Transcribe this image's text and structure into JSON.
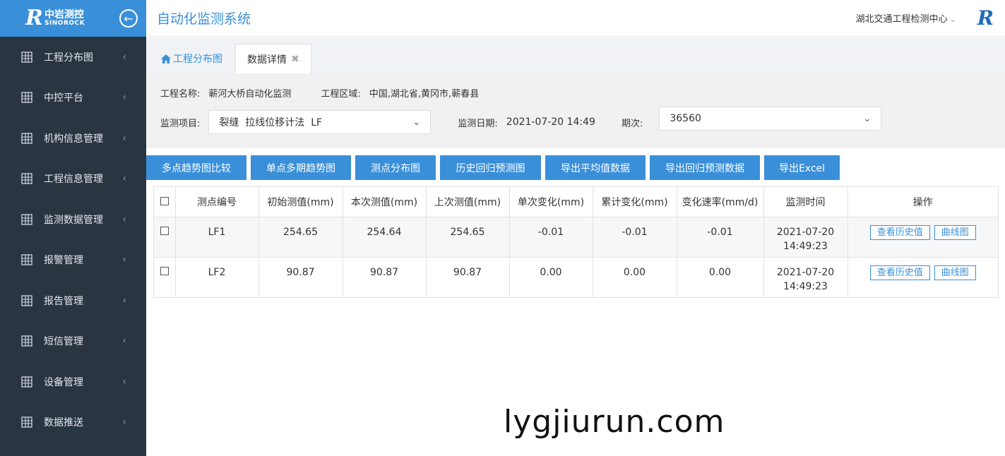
{
  "sidebar": {
    "logo_mark": "R",
    "logo_cn": "中岩测控",
    "logo_en": "SINOROCK",
    "items": [
      {
        "label": "工程分布图"
      },
      {
        "label": "中控平台"
      },
      {
        "label": "机构信息管理"
      },
      {
        "label": "工程信息管理"
      },
      {
        "label": "监测数据管理"
      },
      {
        "label": "报警管理"
      },
      {
        "label": "报告管理"
      },
      {
        "label": "短信管理"
      },
      {
        "label": "设备管理"
      },
      {
        "label": "数据推送"
      }
    ]
  },
  "header": {
    "title": "自动化监测系统",
    "org": "湖北交通工程检测中心",
    "brand_mark": "R"
  },
  "tabs": [
    {
      "label": "工程分布图"
    },
    {
      "label": "数据详情"
    }
  ],
  "filter": {
    "project_name_label": "工程名称:",
    "project_name": "蕲河大桥自动化监测",
    "region_label": "工程区域:",
    "region": "中国,湖北省,黄冈市,蕲春县",
    "item_label": "监测项目:",
    "item_value": "裂缝  拉线位移计法  LF",
    "date_label": "监测日期:",
    "date_value": "2021-07-20 14:49",
    "period_label": "期次:",
    "period_value": "36560"
  },
  "toolbar": [
    {
      "label": "多点趋势图比较"
    },
    {
      "label": "单点多期趋势图"
    },
    {
      "label": "测点分布图"
    },
    {
      "label": "历史回归预测图"
    },
    {
      "label": "导出平均值数据"
    },
    {
      "label": "导出回归预测数据"
    },
    {
      "label": "导出Excel"
    }
  ],
  "table": {
    "headers": [
      "测点编号",
      "初始测值(mm)",
      "本次测值(mm)",
      "上次测值(mm)",
      "单次变化(mm)",
      "累计变化(mm)",
      "变化速率(mm/d)",
      "监测时间",
      "操作"
    ],
    "rows": [
      {
        "id": "LF1",
        "initial": "254.65",
        "current": "254.64",
        "previous": "254.65",
        "single": "-0.01",
        "cumulative": "-0.01",
        "rate": "-0.01",
        "date": "2021-07-20",
        "time": "14:49:23"
      },
      {
        "id": "LF2",
        "initial": "90.87",
        "current": "90.87",
        "previous": "90.87",
        "single": "0.00",
        "cumulative": "0.00",
        "rate": "0.00",
        "date": "2021-07-20",
        "time": "14:49:23"
      }
    ],
    "history_label": "查看历史值",
    "curve_label": "曲线图"
  },
  "watermark": "lygjiurun.com",
  "colors": {
    "accent": "#3a8fd9",
    "sidebar_bg": "#2a3542"
  }
}
